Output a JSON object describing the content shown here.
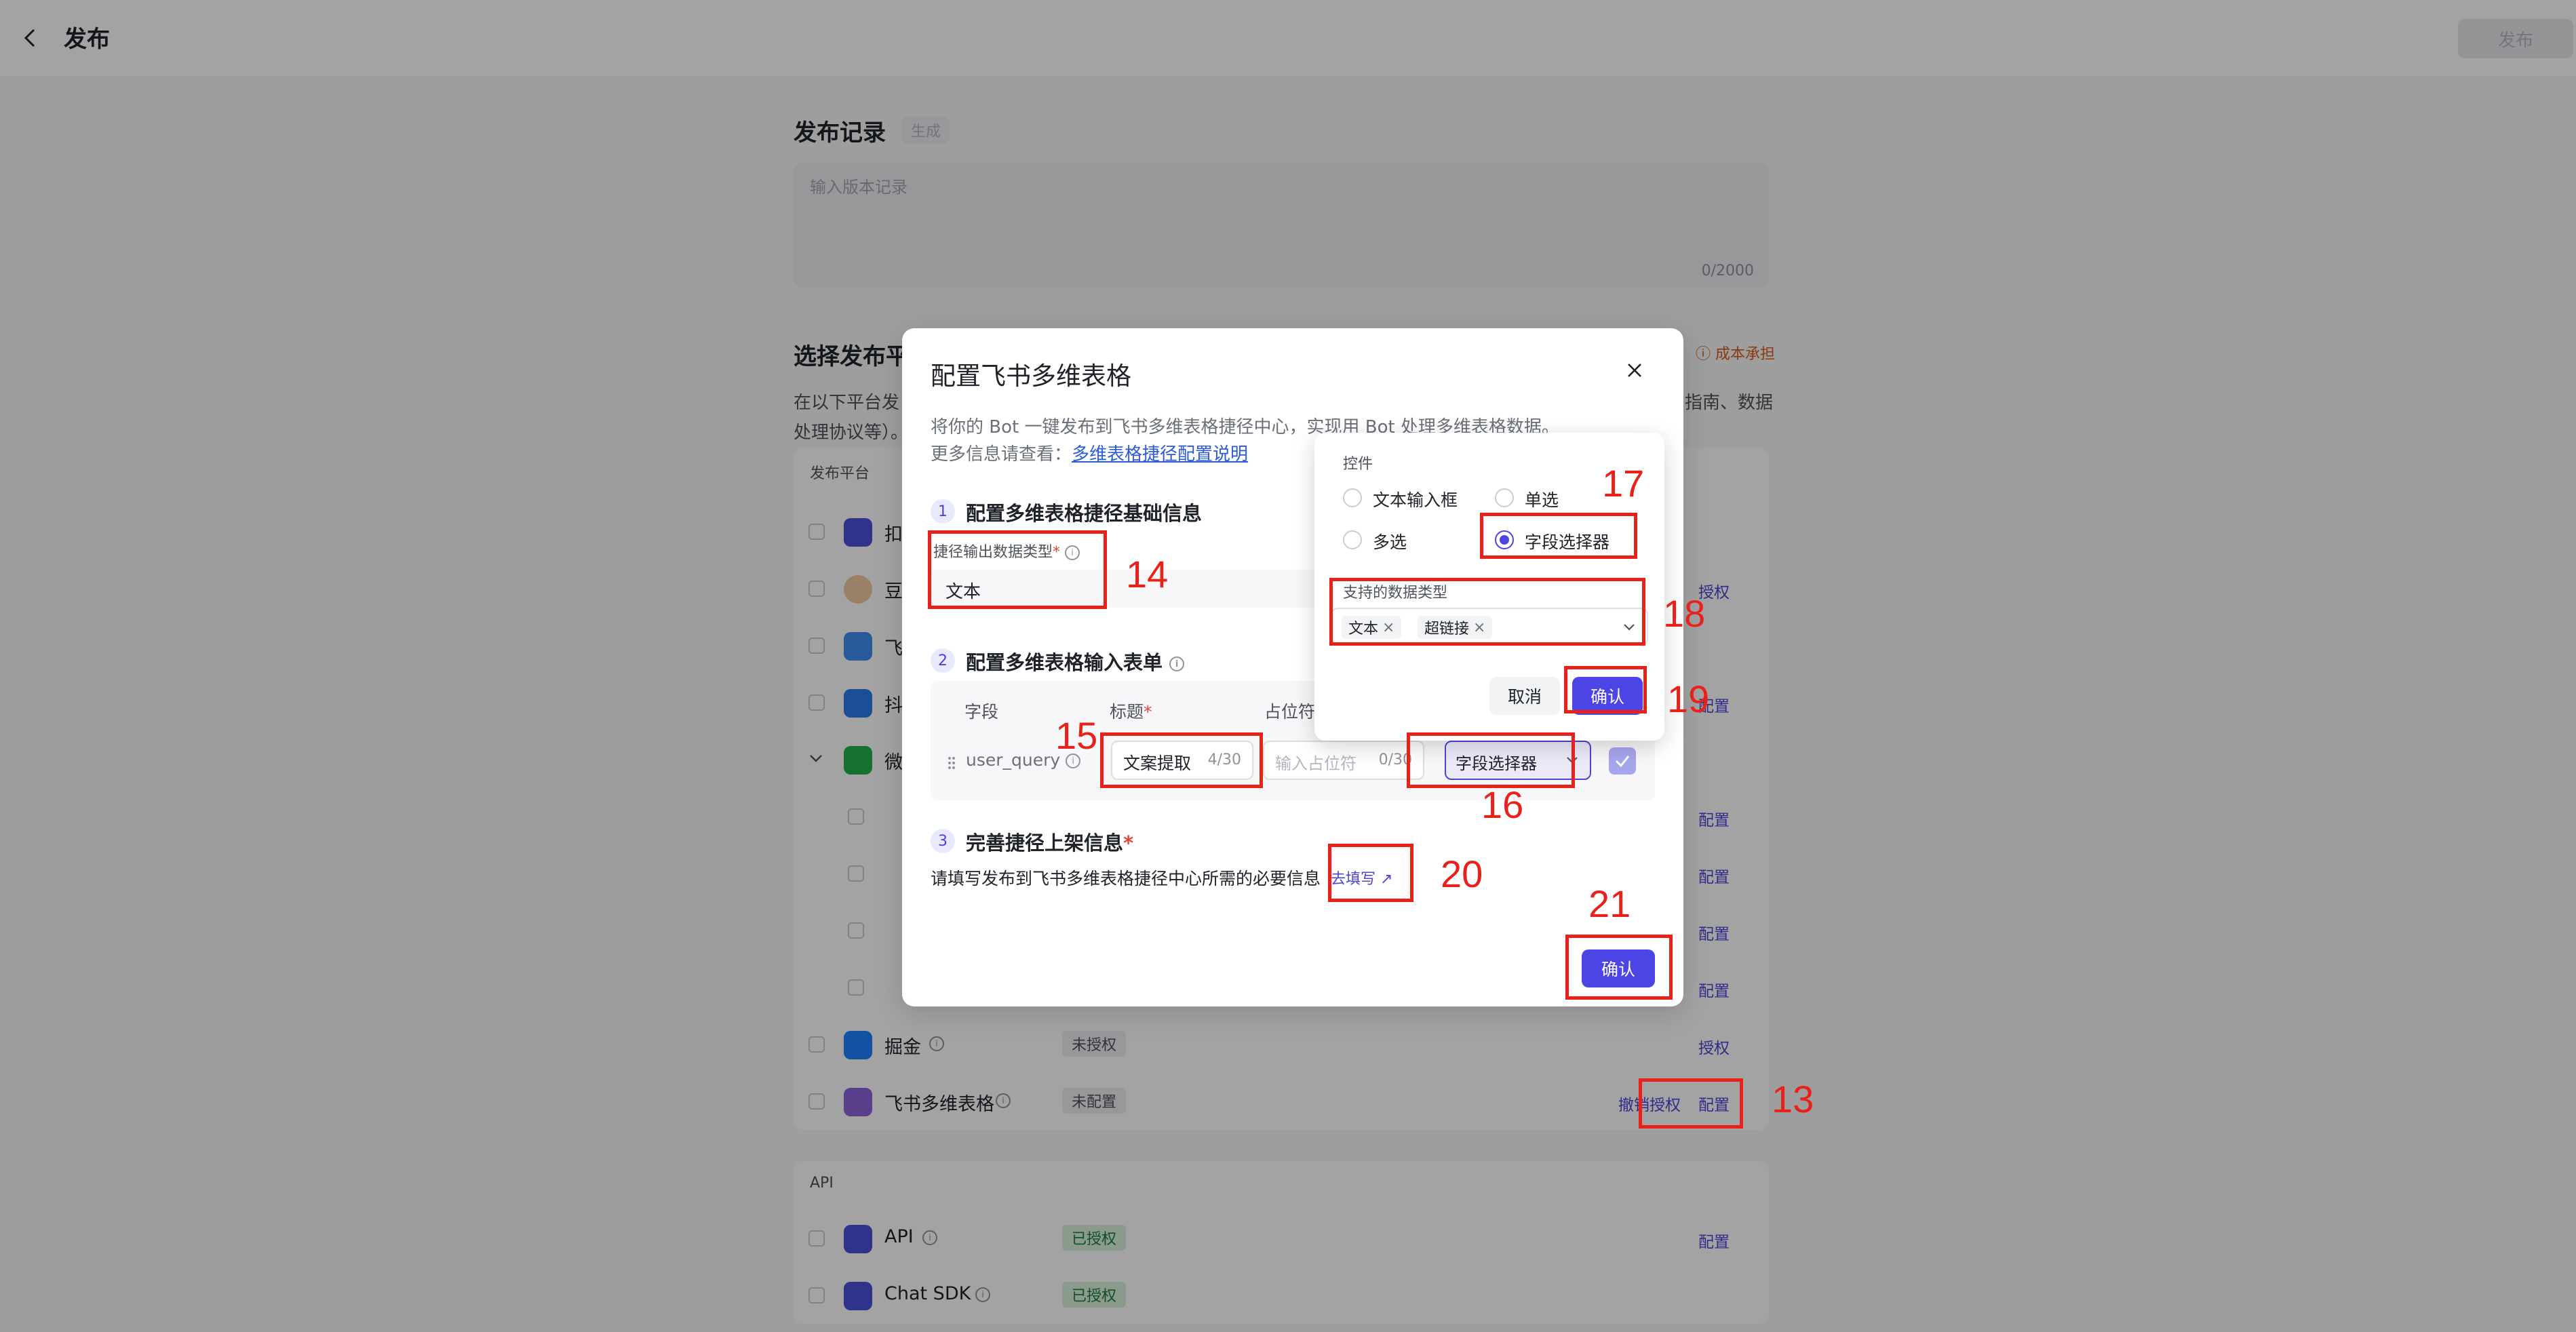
{
  "header": {
    "title": "发布",
    "publish_label": "发布"
  },
  "record": {
    "title": "发布记录",
    "gen_label": "生成",
    "placeholder": "输入版本记录",
    "count": "0/2000"
  },
  "platforms": {
    "title_visible": "选择发布平",
    "cost_link": "成本承担",
    "desc_line1_visible": "在以下平台发",
    "desc_line1_right": "指南、数据",
    "desc_line2_visible": "处理协议等）。",
    "header_label": "发布平台",
    "rows_top": [
      {
        "name": "扣",
        "icon_color": "#4c50d8"
      },
      {
        "name": "豆",
        "icon_color": "#f0c9a2",
        "link": "授权"
      },
      {
        "name": "飞",
        "icon_color": "#3f8cf0"
      },
      {
        "name": "抖",
        "icon_color": "#2b7be8",
        "link": "配置"
      },
      {
        "name": "微",
        "icon_color": "#21b14d"
      }
    ],
    "sub_links": [
      "配置",
      "配置",
      "配置",
      "配置"
    ],
    "juejin": {
      "name": "掘金",
      "status": "未授权",
      "link": "授权"
    },
    "bitable": {
      "name": "飞书多维表格",
      "status": "未配置",
      "revoke": "撤销授权",
      "link": "配置"
    }
  },
  "api_section": {
    "header": "API",
    "rows": [
      {
        "name": "API",
        "status": "已授权",
        "link": "配置"
      },
      {
        "name": "Chat SDK",
        "status": "已授权"
      }
    ]
  },
  "modal": {
    "title": "配置飞书多维表格",
    "desc_line1": "将你的 Bot 一键发布到飞书多维表格捷径中心，实现用 Bot 处理多维表格数据。",
    "desc_line2_prefix": "更多信息请查看：",
    "doc_link": "多维表格捷径配置说明",
    "step1": {
      "num": "1",
      "title": "配置多维表格捷径基础信息",
      "field_label": "捷径输出数据类型",
      "value": "文本"
    },
    "step2": {
      "num": "2",
      "title": "配置多维表格输入表单",
      "col_field": "字段",
      "col_title": "标题",
      "col_placeholder": "占位符",
      "row": {
        "field": "user_query",
        "title_value": "文案提取",
        "title_count": "4/30",
        "placeholder_ph": "输入占位符",
        "placeholder_count": "0/30",
        "control": "字段选择器"
      }
    },
    "step3": {
      "num": "3",
      "title": "完善捷径上架信息",
      "desc": "请填写发布到飞书多维表格捷径中心所需的必要信息",
      "fill_link": "去填写 ↗"
    },
    "confirm": "确认"
  },
  "popover": {
    "control_label": "控件",
    "options": {
      "text_input": "文本输入框",
      "single": "单选",
      "multi": "多选",
      "field_selector": "字段选择器"
    },
    "selected": "字段选择器",
    "types_label": "支持的数据类型",
    "tags": [
      "文本",
      "超链接"
    ],
    "cancel": "取消",
    "confirm": "确认"
  },
  "annotations": [
    "13",
    "14",
    "15",
    "16",
    "17",
    "18",
    "19",
    "20",
    "21"
  ],
  "colors": {
    "accent": "#4d44e5",
    "annotation": "#e8221b",
    "link": "#4b45d6"
  }
}
